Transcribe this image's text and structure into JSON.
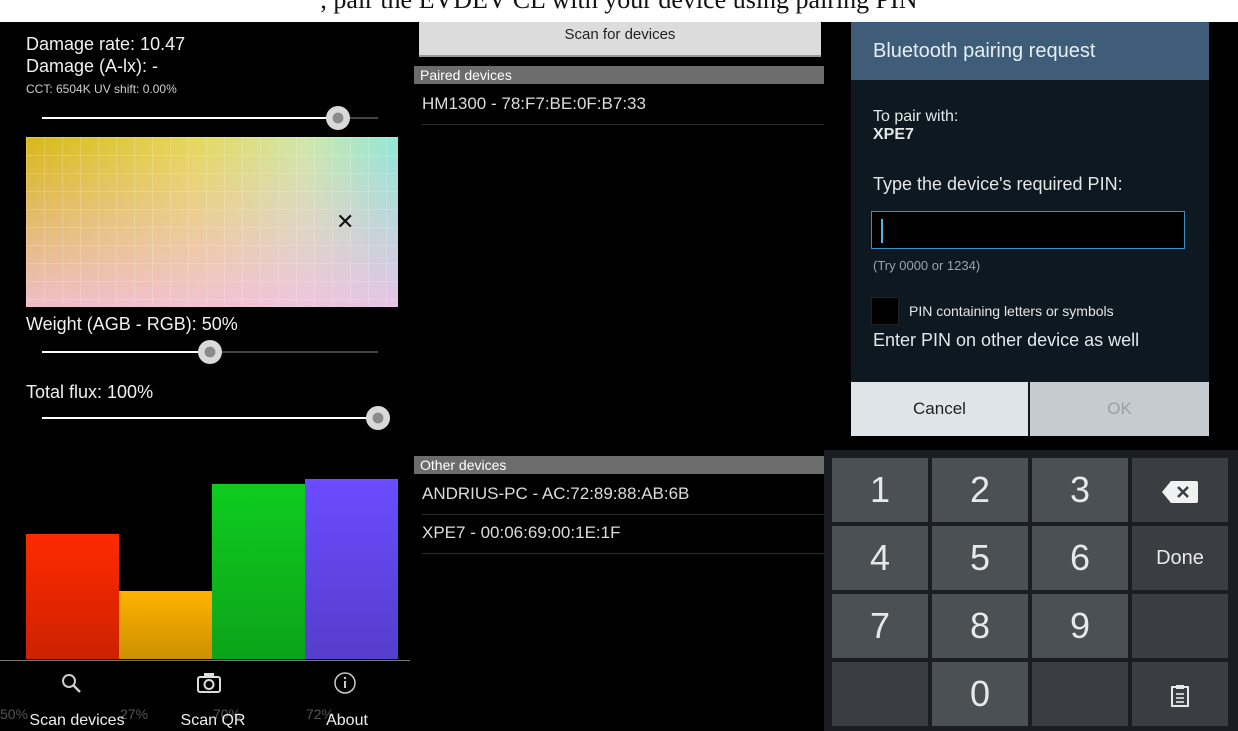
{
  "caption": ", pair the EVDEV CL with your device using pairing PIN",
  "left": {
    "damage_rate": "Damage rate: 10.47",
    "damage_alx": "Damage (A-lx): -",
    "cct": "CCT: 6504K UV shift: 0.00%",
    "cct_slider_level": 0.88,
    "weight_label": "Weight (AGB - RGB): 50%",
    "weight_slider_level": 0.5,
    "flux_label": "Total flux: 100%",
    "flux_slider_level": 1.0,
    "cursor_icon": "crosshair-move-icon",
    "bars": [
      {
        "name": "red",
        "value": 0.5,
        "color": "#ff2a00"
      },
      {
        "name": "amber",
        "value": 0.27,
        "color": "#ffb300"
      },
      {
        "name": "green",
        "value": 0.7,
        "color": "#0fcc1f"
      },
      {
        "name": "blue",
        "value": 0.72,
        "color": "#6b4cff"
      }
    ],
    "bar_pcts": [
      "50%",
      "27%",
      "70%",
      "72%"
    ],
    "nav": [
      {
        "label": "Scan devices",
        "icon": "search-icon"
      },
      {
        "label": "Scan QR",
        "icon": "camera-icon"
      },
      {
        "label": "About",
        "icon": "info-icon"
      }
    ]
  },
  "middle": {
    "scan_button": "Scan for devices",
    "paired_header": "Paired devices",
    "paired": [
      "HM1300 - 78:F7:BE:0F:B7:33"
    ],
    "other_header": "Other devices",
    "other": [
      "ANDRIUS-PC - AC:72:89:88:AB:6B",
      "XPE7 - 00:06:69:00:1E:1F"
    ]
  },
  "dialog": {
    "title": "Bluetooth pairing request",
    "pair_with_label": "To pair with:",
    "device_name": "XPE7",
    "pin_prompt": "Type the device's required PIN:",
    "pin_value": "",
    "hint": "(Try 0000 or 1234)",
    "checkbox_label": "PIN containing letters or symbols",
    "other_device_note": "Enter PIN on other device as well",
    "cancel": "Cancel",
    "ok": "OK"
  },
  "keypad": {
    "keys": [
      "1",
      "2",
      "3",
      "4",
      "5",
      "6",
      "7",
      "8",
      "9",
      "0"
    ],
    "done": "Done",
    "backspace_icon": "backspace-icon",
    "clipboard_icon": "clipboard-icon"
  },
  "colors": {
    "dialog_title_bg": "#3f5d79",
    "pin_border": "#3a8fc5",
    "keypad_key": "#4b5055"
  }
}
